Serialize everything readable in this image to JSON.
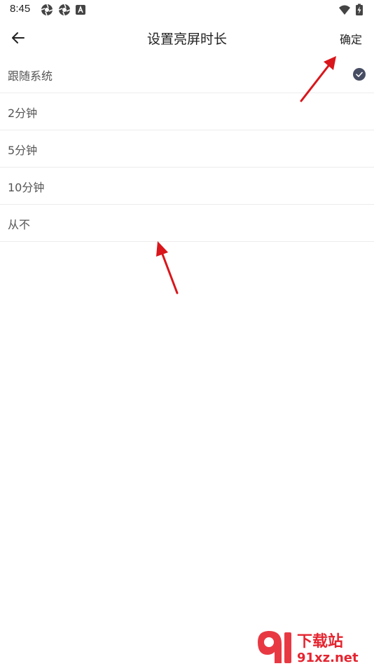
{
  "status_bar": {
    "time": "8:45"
  },
  "header": {
    "title": "设置亮屏时长",
    "confirm_label": "确定"
  },
  "options": [
    {
      "label": "跟随系统",
      "selected": true
    },
    {
      "label": "2分钟",
      "selected": false
    },
    {
      "label": "5分钟",
      "selected": false
    },
    {
      "label": "10分钟",
      "selected": false
    },
    {
      "label": "从不",
      "selected": false
    }
  ],
  "watermark": {
    "title": "下载站",
    "domain": "91xz.net"
  },
  "colors": {
    "check": "#474d63",
    "arrow": "#d9161b",
    "watermark": "#e5242f"
  }
}
